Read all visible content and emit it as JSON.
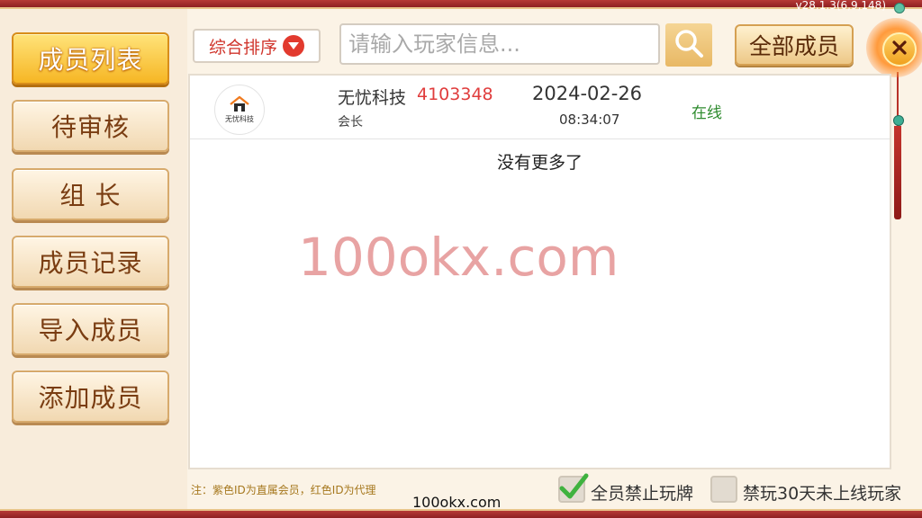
{
  "version": "v28.1.3(6,9,148)",
  "sidebar": {
    "items": [
      {
        "label": "成员列表",
        "active": true
      },
      {
        "label": "待审核",
        "active": false
      },
      {
        "label": "组 长",
        "active": false
      },
      {
        "label": "成员记录",
        "active": false
      },
      {
        "label": "导入成员",
        "active": false
      },
      {
        "label": "添加成员",
        "active": false
      }
    ]
  },
  "toolbar": {
    "sort_label": "综合排序",
    "search_placeholder": "请输入玩家信息...",
    "all_members_label": "全部成员"
  },
  "members": [
    {
      "name": "无忧科技",
      "id": "4103348",
      "role": "会长",
      "date": "2024-02-26",
      "time": "08:34:07",
      "status": "在线",
      "avatar_text": "无忧科技"
    }
  ],
  "list_end_text": "没有更多了",
  "watermark": "100okx.com",
  "footer": {
    "note": "注：紫色ID为直属会员，红色ID为代理",
    "watermark_small": "100okx.com",
    "checkbox1": {
      "label": "全员禁止玩牌",
      "checked": true
    },
    "checkbox2": {
      "label": "禁玩30天未上线玩家",
      "checked": false
    }
  },
  "colors": {
    "accent": "#f6b624",
    "id_red": "#e03c3c",
    "online_green": "#2e8b2e",
    "border_red": "#a32a2a"
  }
}
